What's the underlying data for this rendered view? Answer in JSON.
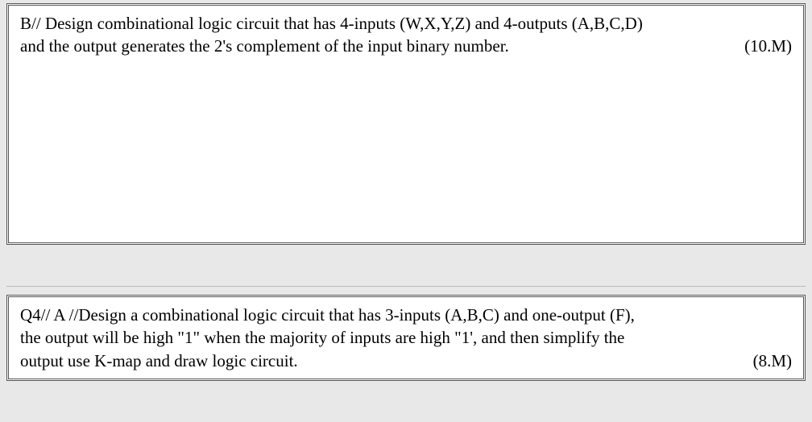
{
  "question_b": {
    "prefix": "B//",
    "line1": "Design combinational  logic circuit  that has 4-inputs (W,X,Y,Z) and 4-outputs (A,B,C,D)",
    "line2_left": "and the output generates the 2's complement of the input binary number.",
    "marks": "(10.M)"
  },
  "question_q4a": {
    "prefix": "Q4// A //",
    "line1_rest": "Design a combinational  logic circuit that has 3-inputs (A,B,C) and one-output (F),",
    "line2": "the output will be high \"1\" when the majority of inputs are high \"1', and then simplify the",
    "line3_left": "output use K-map and draw logic circuit.",
    "marks": "(8.M)"
  }
}
